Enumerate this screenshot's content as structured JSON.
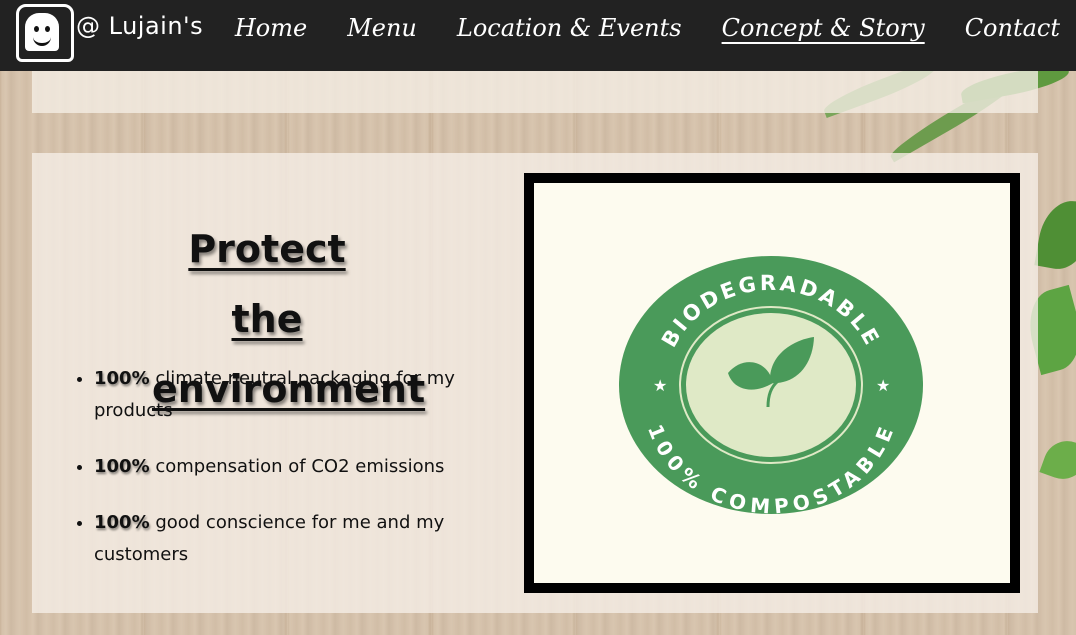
{
  "nav": {
    "brand": "@ Lujain's",
    "links": [
      {
        "label": "Home",
        "active": false
      },
      {
        "label": "Menu",
        "active": false
      },
      {
        "label": "Location & Events",
        "active": false
      },
      {
        "label": "Concept & Story",
        "active": true
      },
      {
        "label": "Contact",
        "active": false
      }
    ]
  },
  "section": {
    "heading": "Protect the environment",
    "bullets": [
      {
        "pct": "100%",
        "text": " climate neutral packaging for my products"
      },
      {
        "pct": "100%",
        "text": " compensation of CO2 emissions"
      },
      {
        "pct": "100%",
        "text": " good conscience for me and my customers"
      }
    ]
  },
  "badge": {
    "top_text": "BIODEGRADABLE",
    "bottom_text": "100% COMPOSTABLE",
    "icon": "leaves-icon",
    "color": "#4a9a5a"
  },
  "colors": {
    "nav_bg": "#222222",
    "accent_green": "#4a9a5a"
  }
}
